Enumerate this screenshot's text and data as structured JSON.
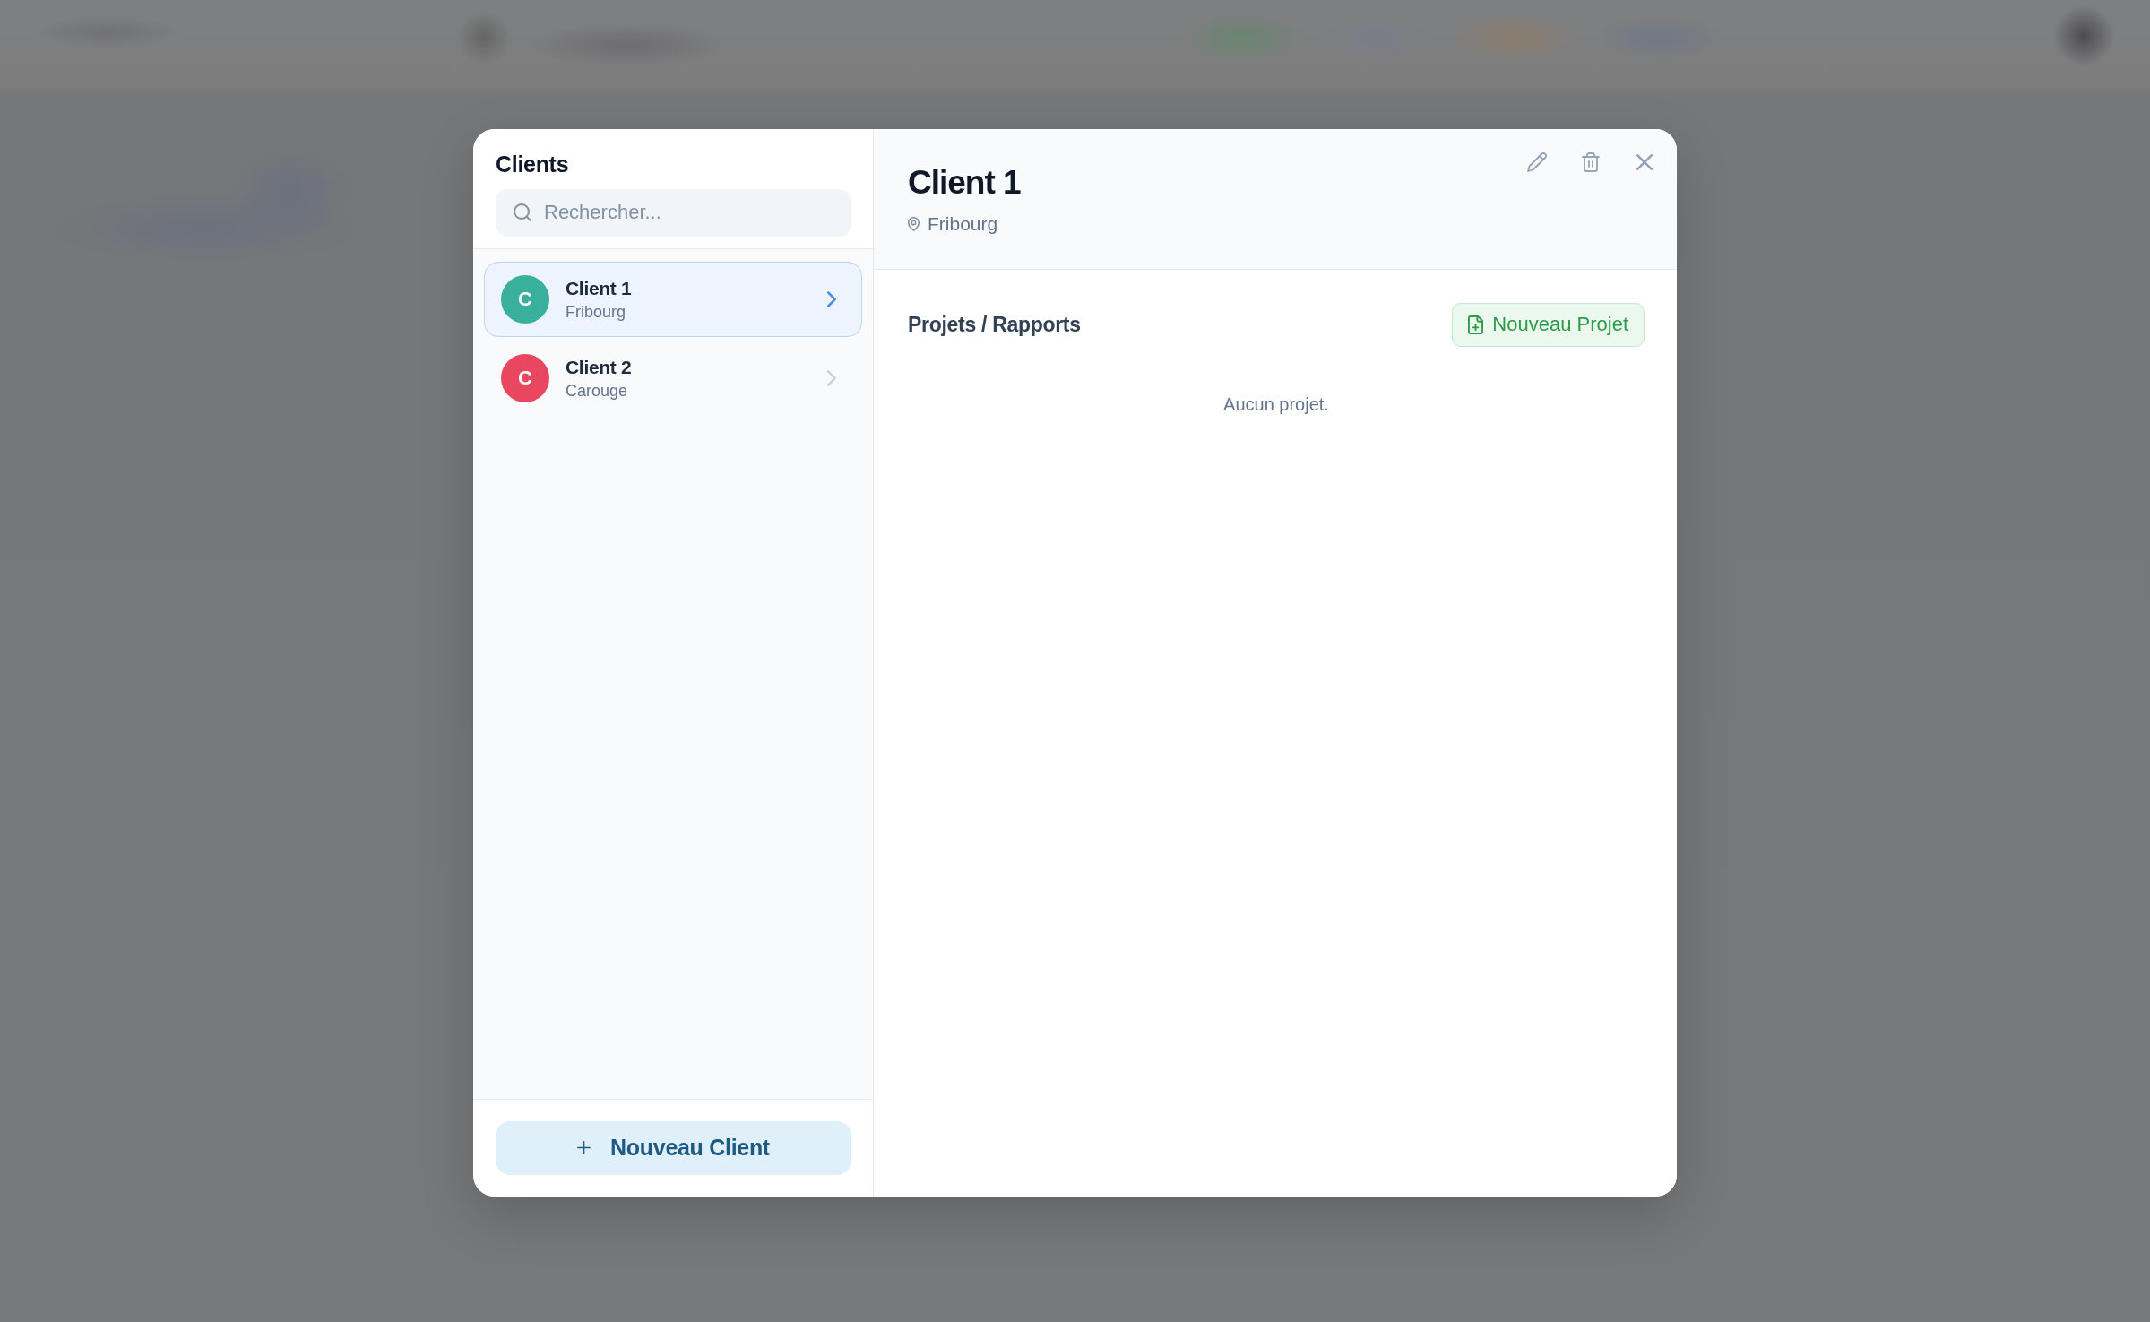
{
  "clients_panel": {
    "title": "Clients",
    "search": {
      "placeholder": "Rechercher..."
    },
    "clients": [
      {
        "initial": "C",
        "name": "Client 1",
        "city": "Fribourg",
        "color": "#38b09c",
        "selected": true
      },
      {
        "initial": "C",
        "name": "Client 2",
        "city": "Carouge",
        "color": "#e8475f",
        "selected": false
      }
    ],
    "new_client_button": "Nouveau Client"
  },
  "client_detail": {
    "title": "Client 1",
    "location": "Fribourg",
    "section_title": "Projets / Rapports",
    "new_project_button": "Nouveau Projet",
    "empty_message": "Aucun projet."
  }
}
